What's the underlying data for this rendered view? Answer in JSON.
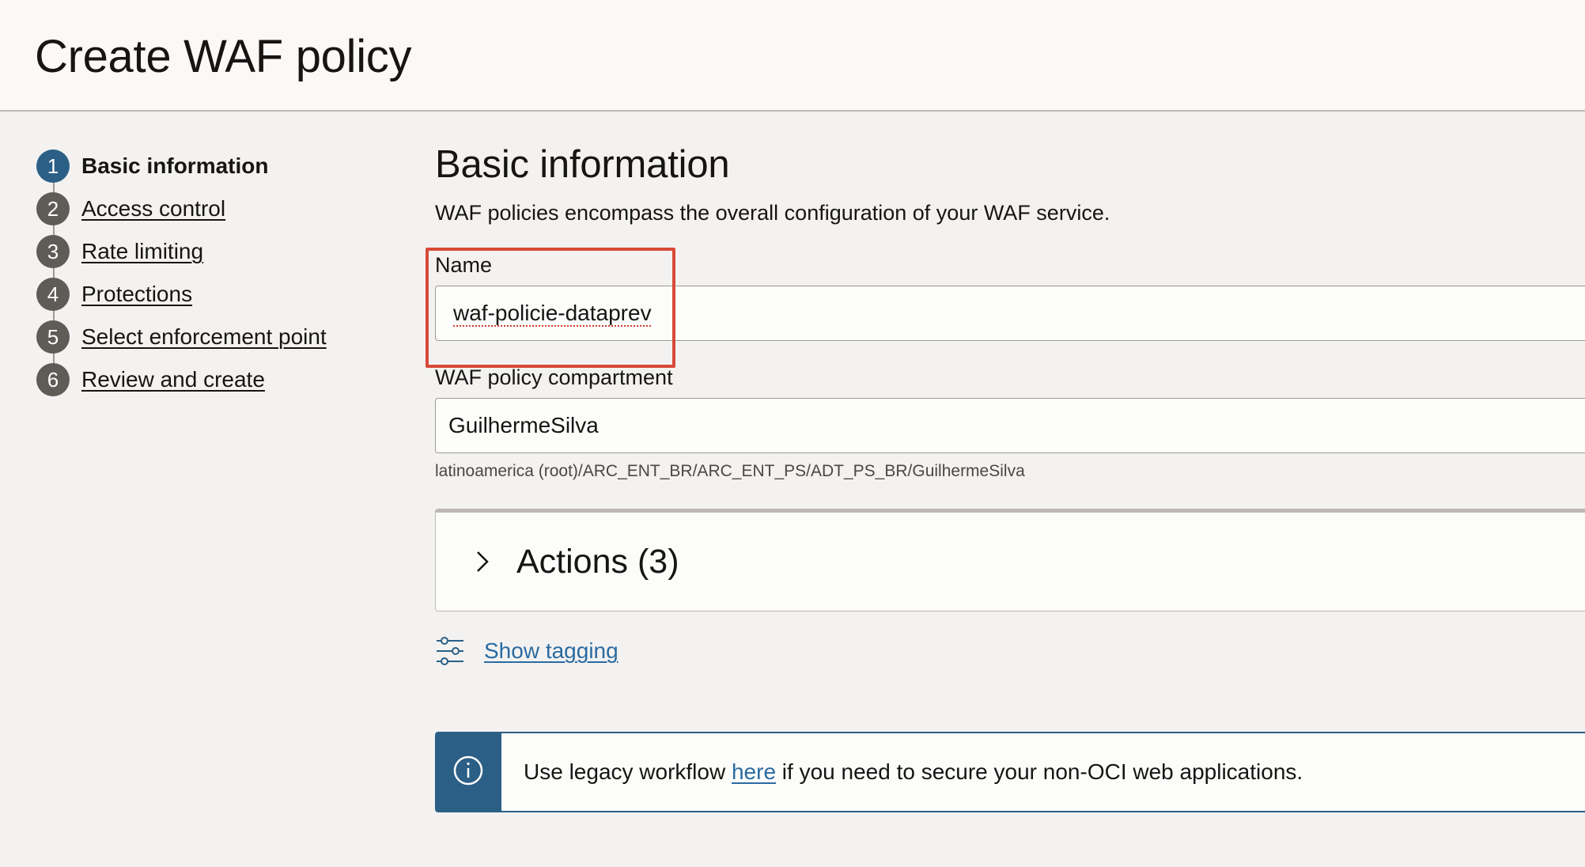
{
  "header": {
    "title": "Create WAF policy"
  },
  "steps": [
    {
      "num": "1",
      "label": "Basic information",
      "active": true
    },
    {
      "num": "2",
      "label": "Access control"
    },
    {
      "num": "3",
      "label": "Rate limiting"
    },
    {
      "num": "4",
      "label": "Protections"
    },
    {
      "num": "5",
      "label": "Select enforcement point"
    },
    {
      "num": "6",
      "label": "Review and create"
    }
  ],
  "main": {
    "title": "Basic information",
    "description": "WAF policies encompass the overall configuration of your WAF service.",
    "name_field": {
      "label": "Name",
      "value": "waf-policie-dataprev"
    },
    "compartment_field": {
      "label": "WAF policy compartment",
      "value": "GuilhermeSilva",
      "path": "latinoamerica (root)/ARC_ENT_BR/ARC_ENT_PS/ADT_PS_BR/GuilhermeSilva"
    },
    "actions": {
      "title": "Actions (3)"
    },
    "tagging": {
      "label": "Show tagging"
    },
    "info": {
      "prefix": "Use legacy workflow ",
      "link": "here",
      "suffix": " if you need to secure your non-OCI web applications."
    }
  },
  "colors": {
    "accent": "#2b5f86",
    "link": "#2b6ba1",
    "highlight": "#d84a38",
    "step_inactive": "#5f5b57"
  },
  "icons": {
    "step_marker": "numbered-circle",
    "actions": "chevron-right-icon",
    "tagging": "sliders-icon",
    "info": "info-circle-icon"
  }
}
